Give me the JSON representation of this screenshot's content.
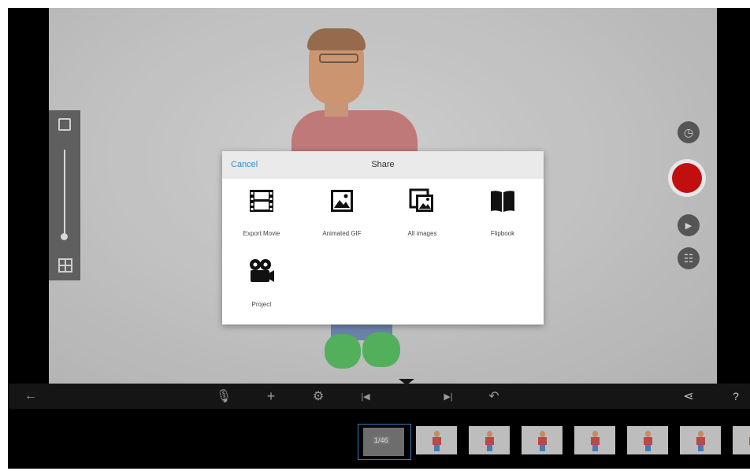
{
  "dialog": {
    "cancel_label": "Cancel",
    "title": "Share",
    "options": [
      {
        "label": "Export Movie",
        "icon": "film-icon"
      },
      {
        "label": "Animated GIF",
        "icon": "image-icon"
      },
      {
        "label": "All images",
        "icon": "images-stack-icon"
      },
      {
        "label": "Flipbook",
        "icon": "book-icon"
      },
      {
        "label": "Project",
        "icon": "movie-camera-icon"
      }
    ]
  },
  "filmstrip": {
    "current_frame_label": "1/46",
    "visible_thumbnails": 8
  },
  "colors": {
    "accent": "#2f8fc7",
    "record": "#c10f0f"
  }
}
